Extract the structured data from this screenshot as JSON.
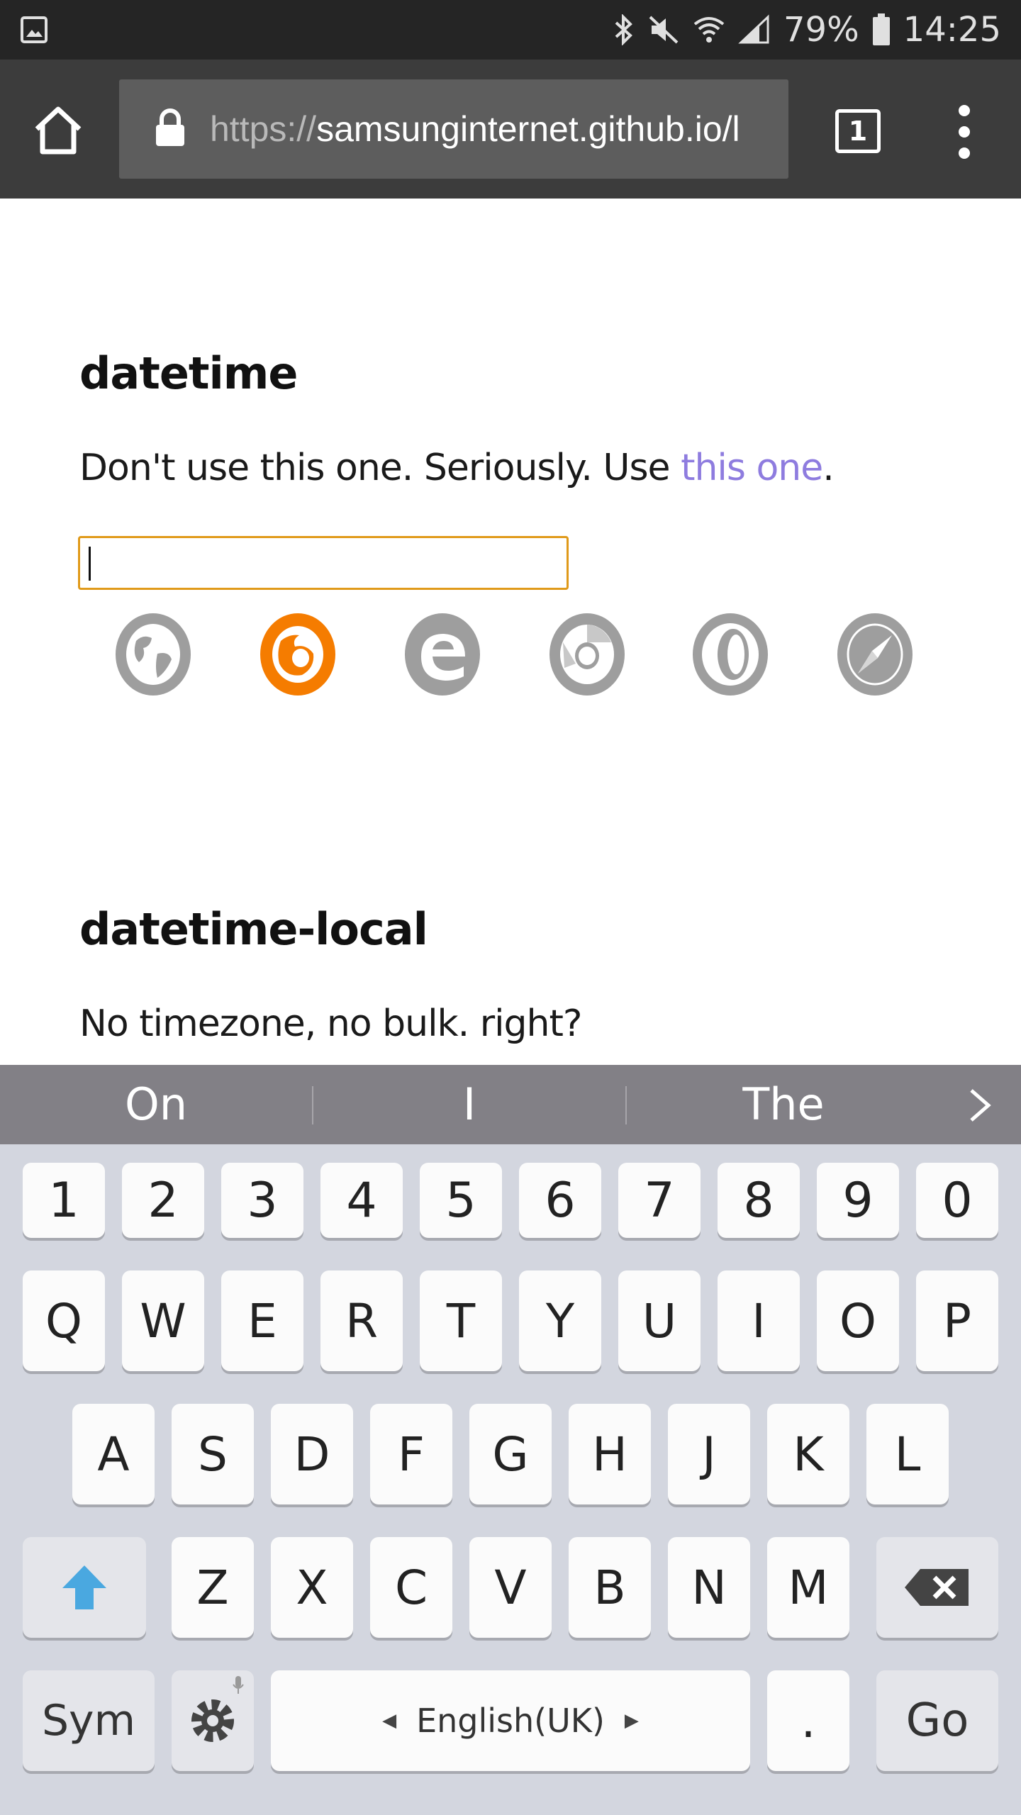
{
  "status_bar": {
    "battery": "79%",
    "time": "14:25",
    "icons": [
      "gallery-icon",
      "bluetooth-icon",
      "mute-icon",
      "wifi-icon",
      "signal-icon",
      "battery-icon"
    ]
  },
  "browser": {
    "url_scheme": "https://",
    "url_host": "samsunginternet.github.io/l",
    "tab_count": "1"
  },
  "page": {
    "section1": {
      "title": "datetime",
      "text_before": "Don't use this one. Seriously. Use ",
      "link": "this one",
      "text_after": ".",
      "input_value": ""
    },
    "browsers": [
      "samsung-internet-icon",
      "firefox-icon",
      "edge-icon",
      "chrome-icon",
      "opera-icon",
      "safari-icon"
    ],
    "supported_color": "#f57c00",
    "unsupported_color": "#9e9e9e",
    "section2": {
      "title": "datetime-local",
      "text": "No timezone, no bulk. right?"
    }
  },
  "keyboard": {
    "suggestions": [
      "On",
      "I",
      "The"
    ],
    "row_numbers": [
      "1",
      "2",
      "3",
      "4",
      "5",
      "6",
      "7",
      "8",
      "9",
      "0"
    ],
    "row_top": [
      "Q",
      "W",
      "E",
      "R",
      "T",
      "Y",
      "U",
      "I",
      "O",
      "P"
    ],
    "row_middle": [
      "A",
      "S",
      "D",
      "F",
      "G",
      "H",
      "J",
      "K",
      "L"
    ],
    "row_bottom": [
      "Z",
      "X",
      "C",
      "V",
      "B",
      "N",
      "M"
    ],
    "sym": "Sym",
    "language": "English(UK)",
    "period": ".",
    "go": "Go",
    "shift_color": "#4aa8e0"
  }
}
